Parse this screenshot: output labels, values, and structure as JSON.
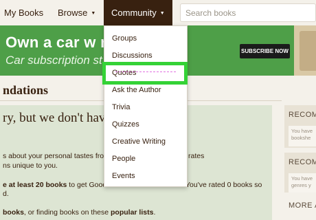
{
  "nav": {
    "my_books": "My Books",
    "browse": "Browse",
    "community": "Community",
    "caret": "▼",
    "search_placeholder": "Search books"
  },
  "ad": {
    "line1": "Own a car w       ng it.",
    "line2": "Car subscription st         r month.",
    "cta": "SUBSCRIBE NOW"
  },
  "page": {
    "title": "ndations",
    "notice_heading": "ry, but we don't have      mendations",
    "p1": "s about your personal tastes fro",
    "p1_right": "rates",
    "p2": "ns unique to you.",
    "p3_bold": "e at least 20 books",
    "p3_rest": " to get Good",
    "p3_right": "You've rated 0 books so",
    "p4": "d.",
    "p5_bold": "books",
    "p5_mid": ", or finding books on these ",
    "p5_bold2": "popular lists",
    "p5_end": "."
  },
  "sidebar": {
    "card1_heading": "RECOM",
    "card1_body_1": "You have",
    "card1_body_2": "bookshe",
    "card2_heading": "RECOM",
    "card2_body_1": "You have",
    "card2_body_2": "genres y",
    "card3_heading": "MORE A"
  },
  "menu": {
    "items": [
      "Groups",
      "Discussions",
      "Quotes",
      "Ask the Author",
      "Trivia",
      "Quizzes",
      "Creative Writing",
      "People",
      "Events"
    ],
    "highlighted": "Quotes",
    "highlight_color": "#34d236"
  },
  "colors": {
    "nav_active": "#382110",
    "ad_green": "#4e9f48",
    "notice_bg": "#dde5d3"
  }
}
